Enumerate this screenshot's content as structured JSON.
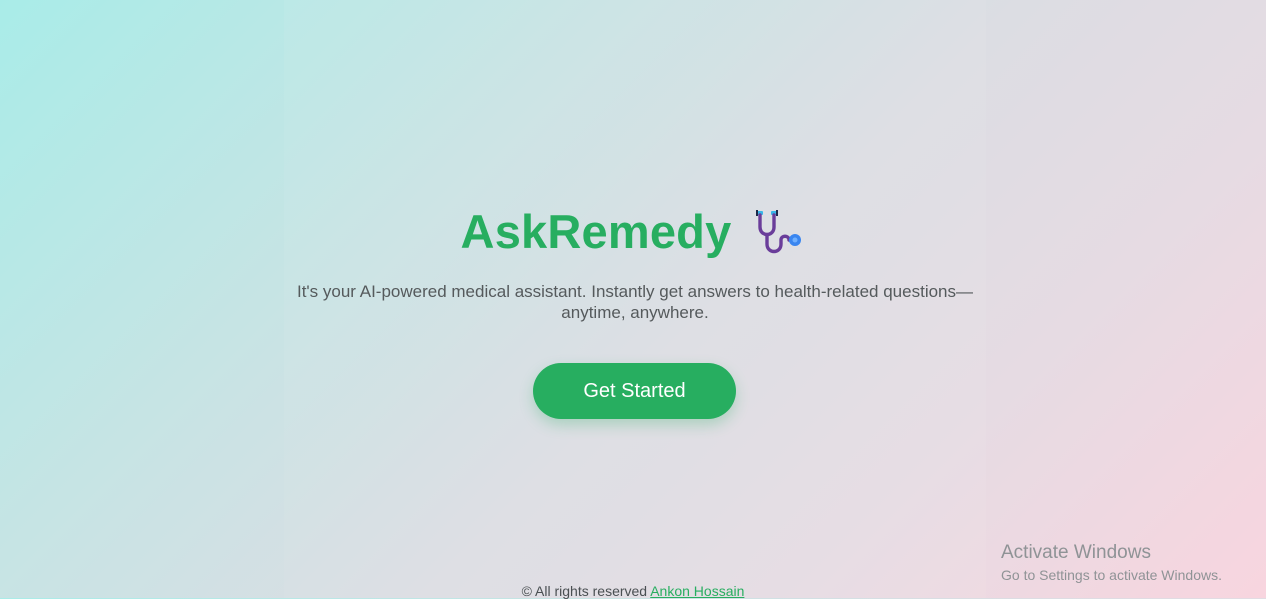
{
  "hero": {
    "title": "AskRemedy",
    "icon": "stethoscope-icon",
    "subtitle": "It's your AI-powered medical assistant. Instantly get answers to health-related questions—anytime, anywhere.",
    "cta_label": "Get Started"
  },
  "footer": {
    "copyright": "© All rights reserved",
    "author_link": "Ankon Hossain"
  },
  "os_overlay": {
    "line1": "Activate Windows",
    "line2": "Go to Settings to activate Windows."
  },
  "colors": {
    "accent": "#27ae60",
    "text": "#555a5c"
  }
}
